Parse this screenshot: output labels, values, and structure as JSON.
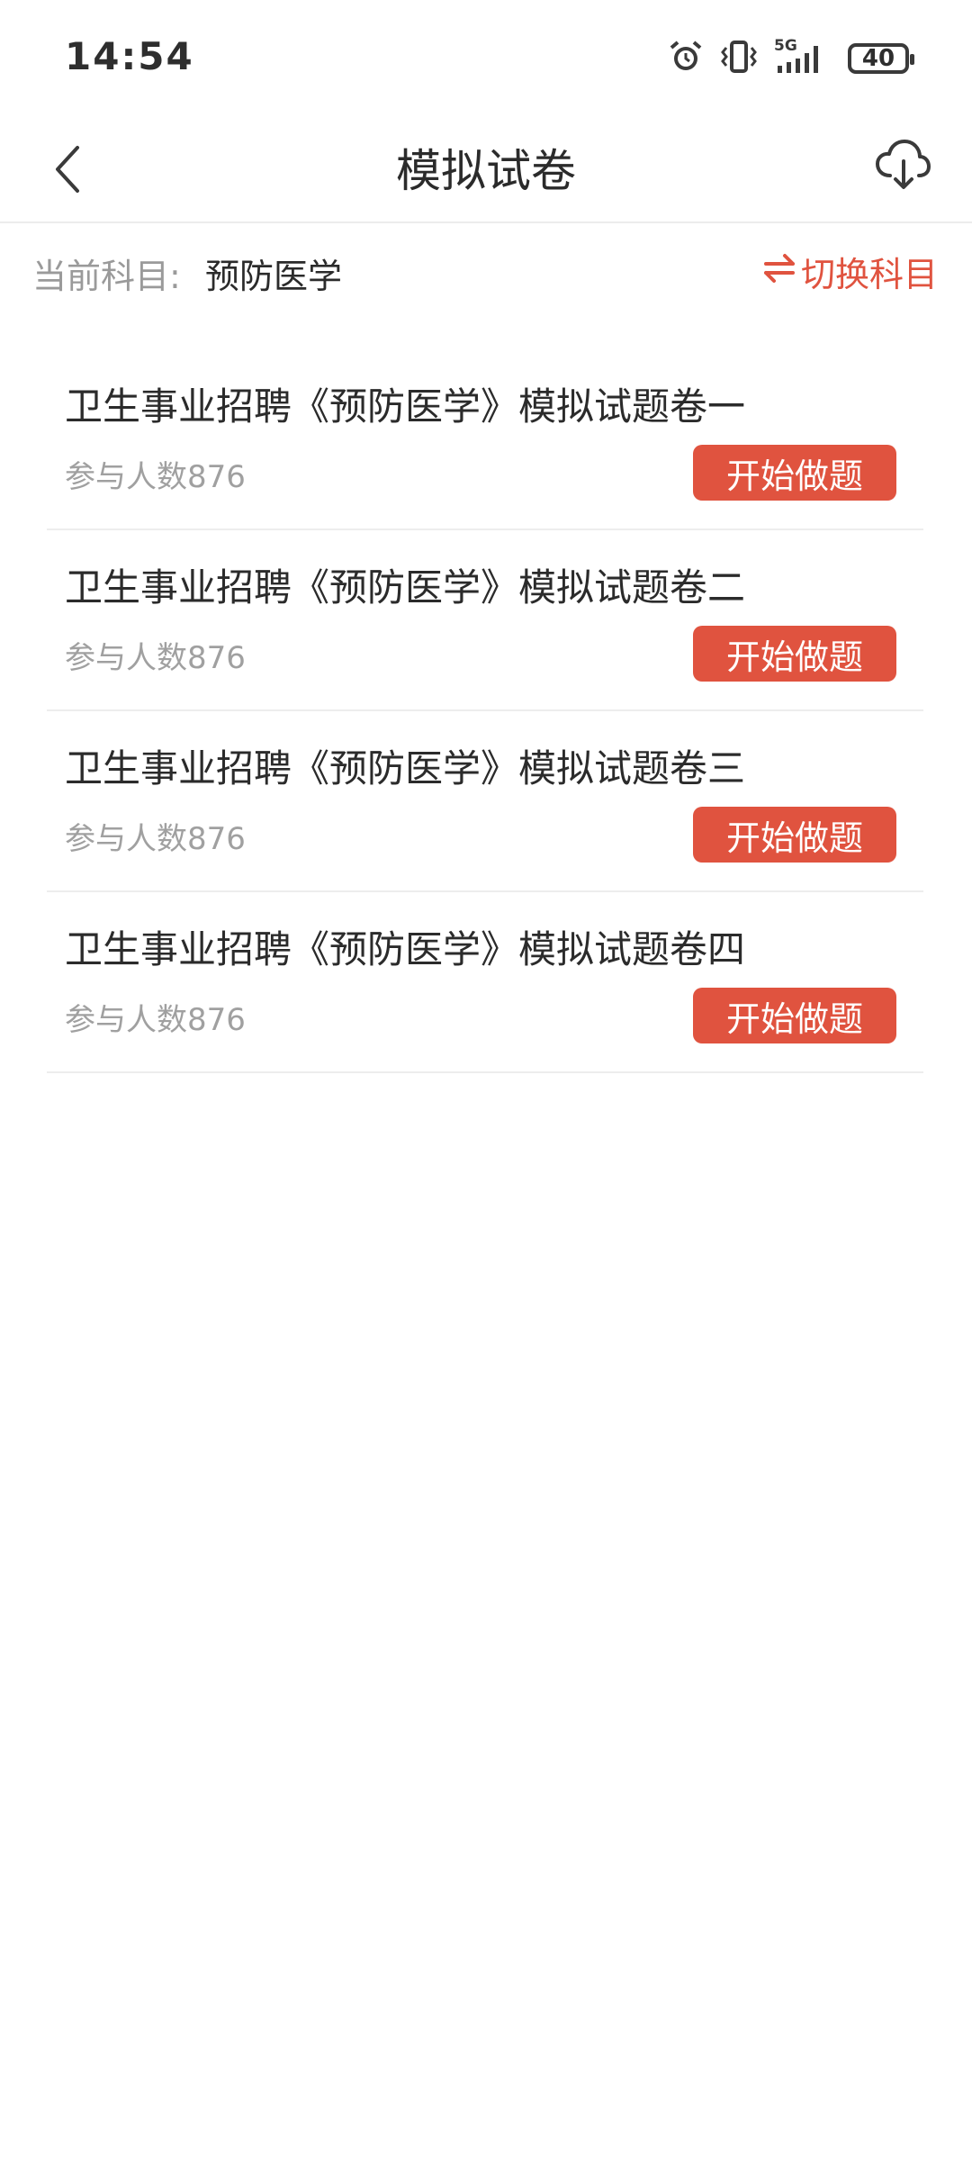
{
  "status_bar": {
    "time": "14:54",
    "network": "5G",
    "battery": "40",
    "icons": [
      "alarm-icon",
      "vibrate-icon",
      "signal-5g-icon",
      "battery-icon"
    ]
  },
  "nav": {
    "title": "模拟试卷",
    "back_icon": "chevron-left-icon",
    "download_icon": "cloud-download-icon"
  },
  "subject": {
    "label": "当前科目:",
    "value": "预防医学",
    "switch_icon": "swap-icon",
    "switch_label": "切换科目"
  },
  "papers": [
    {
      "title": "卫生事业招聘《预防医学》模拟试题卷一",
      "count": "参与人数876",
      "button": "开始做题"
    },
    {
      "title": "卫生事业招聘《预防医学》模拟试题卷二",
      "count": "参与人数876",
      "button": "开始做题"
    },
    {
      "title": "卫生事业招聘《预防医学》模拟试题卷三",
      "count": "参与人数876",
      "button": "开始做题"
    },
    {
      "title": "卫生事业招聘《预防医学》模拟试题卷四",
      "count": "参与人数876",
      "button": "开始做题"
    }
  ],
  "colors": {
    "accent": "#e0533f",
    "text": "#2b2b2b",
    "muted": "#a0a0a0"
  }
}
